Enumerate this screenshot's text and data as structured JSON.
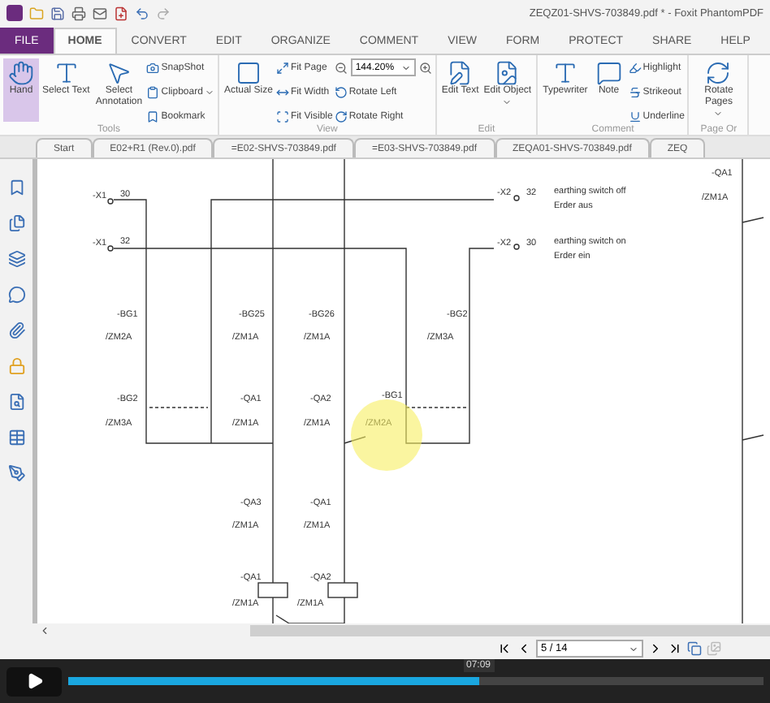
{
  "title_bar": {
    "title": "ZEQZ01-SHVS-703849.pdf * - Foxit PhantomPDF"
  },
  "ribbon_tabs": [
    {
      "label": "FILE",
      "kind": "file",
      "selected": false
    },
    {
      "label": "HOME",
      "kind": "tab",
      "selected": true
    },
    {
      "label": "CONVERT",
      "kind": "tab",
      "selected": false
    },
    {
      "label": "EDIT",
      "kind": "tab",
      "selected": false
    },
    {
      "label": "ORGANIZE",
      "kind": "tab",
      "selected": false
    },
    {
      "label": "COMMENT",
      "kind": "tab",
      "selected": false
    },
    {
      "label": "VIEW",
      "kind": "tab",
      "selected": false
    },
    {
      "label": "FORM",
      "kind": "tab",
      "selected": false
    },
    {
      "label": "PROTECT",
      "kind": "tab",
      "selected": false
    },
    {
      "label": "SHARE",
      "kind": "tab",
      "selected": false
    },
    {
      "label": "HELP",
      "kind": "tab",
      "selected": false
    }
  ],
  "ribbon_groups": [
    {
      "label": "Tools",
      "columns": [
        [
          {
            "kind": "large",
            "label": "Hand",
            "selected": true
          }
        ],
        [
          {
            "kind": "large",
            "label": "Select Text",
            "selected": false
          }
        ],
        [
          {
            "kind": "large",
            "label": "Select Annotation",
            "selected": false
          }
        ],
        [
          {
            "kind": "small",
            "label": "SnapShot",
            "dropdown": false
          },
          {
            "kind": "small",
            "label": "Clipboard",
            "dropdown": true
          },
          {
            "kind": "small",
            "label": "Bookmark",
            "dropdown": false
          }
        ]
      ]
    },
    {
      "label": "View",
      "columns": [
        [
          {
            "kind": "large",
            "label": "Actual Size",
            "selected": false
          }
        ],
        [
          {
            "kind": "small",
            "label": "Fit Page",
            "dropdown": false
          },
          {
            "kind": "small",
            "label": "Fit Width",
            "dropdown": false
          },
          {
            "kind": "small",
            "label": "Fit Visible",
            "dropdown": false
          }
        ],
        [
          {
            "kind": "zoom",
            "value": "144.20%"
          },
          {
            "kind": "small",
            "label": "Rotate Left",
            "dropdown": false
          },
          {
            "kind": "small",
            "label": "Rotate Right",
            "dropdown": false
          }
        ]
      ]
    },
    {
      "label": "Edit",
      "columns": [
        [
          {
            "kind": "large",
            "label": "Edit Text",
            "selected": false
          }
        ],
        [
          {
            "kind": "large",
            "label": "Edit Object",
            "selected": false,
            "dropdown": true
          }
        ]
      ]
    },
    {
      "label": "Comment",
      "columns": [
        [
          {
            "kind": "large",
            "label": "Typewriter",
            "selected": false
          }
        ],
        [
          {
            "kind": "large",
            "label": "Note",
            "selected": false
          }
        ],
        [
          {
            "kind": "small",
            "label": "Highlight",
            "dropdown": false
          },
          {
            "kind": "small",
            "label": "Strikeout",
            "dropdown": false
          },
          {
            "kind": "small",
            "label": "Underline",
            "dropdown": false
          }
        ]
      ]
    },
    {
      "label": "Page Or",
      "columns": [
        [
          {
            "kind": "large",
            "label": "Rotate Pages",
            "selected": false,
            "dropdown": true
          }
        ]
      ]
    }
  ],
  "document_tabs": [
    "Start",
    "E02+R1 (Rev.0).pdf",
    "=E02-SHVS-703849.pdf",
    "=E03-SHVS-703849.pdf",
    "ZEQA01-SHVS-703849.pdf",
    "ZEQ"
  ],
  "schematic": {
    "labels": [
      "-X1",
      "30",
      "-X1",
      "32",
      "-BG1",
      "/ZM2A",
      "-BG25",
      "/ZM1A",
      "-BG26",
      "/ZM1A",
      "-BG2",
      "/ZM3A",
      "-QA1",
      "/ZM1A",
      "-QA2",
      "/ZM1A",
      "-BG1",
      "/ZM2A",
      "-QA3",
      "/ZM1A",
      "-QA1",
      "/ZM1A",
      "-QA1",
      "/ZM1A",
      "-QA2",
      "/ZM1A",
      "-X2",
      "32",
      "earthing switch off",
      "Erder aus",
      "-X2",
      "30",
      "earthing switch on",
      "Erder ein",
      "-BG2",
      "/ZM3A",
      "-QA1",
      "/ZM1A"
    ]
  },
  "page_navigation": {
    "value": "5 / 14"
  },
  "video_player": {
    "time": "07:09",
    "level": 0.59
  }
}
